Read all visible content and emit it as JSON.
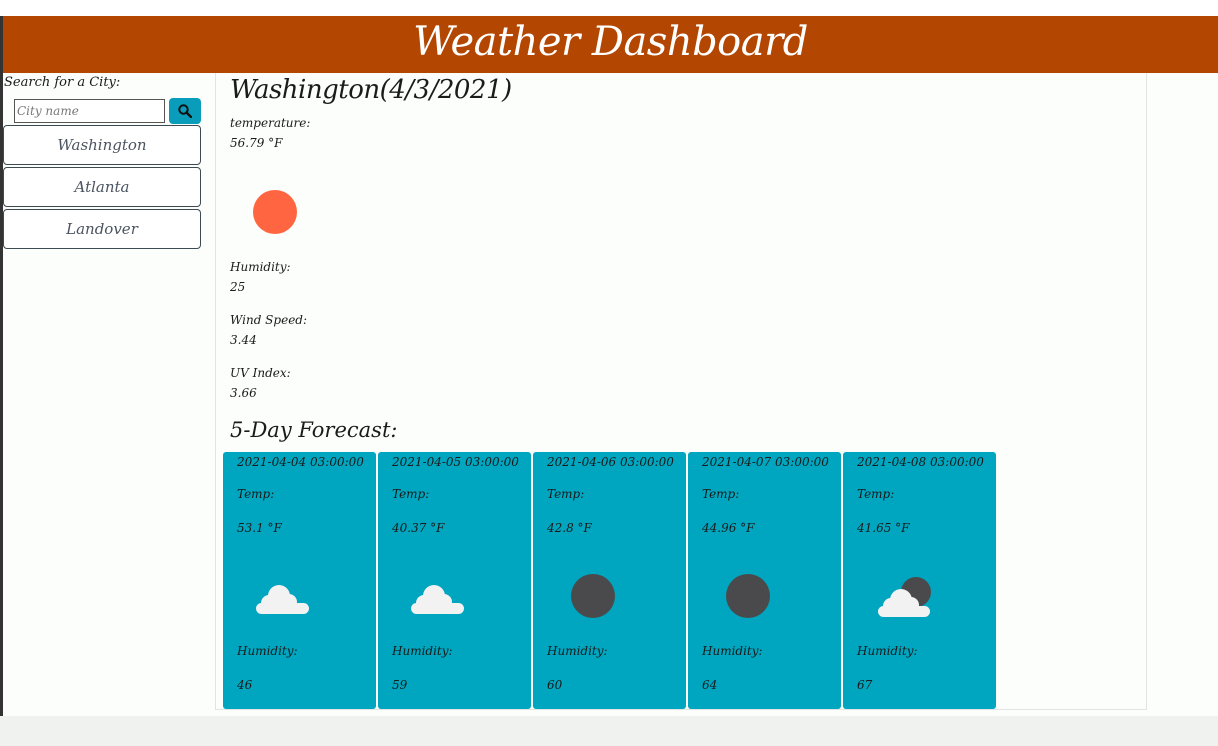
{
  "header": {
    "title": "Weather Dashboard"
  },
  "sidebar": {
    "search_label": "Search for a City:",
    "search_placeholder": "City name",
    "search_icon": "search-icon",
    "cities": [
      "Washington",
      "Atlanta",
      "Landover"
    ]
  },
  "current": {
    "title": "Washington(4/3/2021)",
    "temperature_label": "temperature:",
    "temperature_value": "56.79 °F",
    "icon": "sun-icon",
    "humidity_label": "Humidity:",
    "humidity_value": "25",
    "wind_label": "Wind Speed:",
    "wind_value": "3.44",
    "uv_label": "UV Index:",
    "uv_value": "3.66"
  },
  "forecast": {
    "title": "5-Day Forecast:",
    "temp_label": "Temp:",
    "humidity_label": "Humidity:",
    "days": [
      {
        "date": "2021-04-04 03:00:00",
        "temp": "53.1 °F",
        "humidity": "46",
        "icon": "cloud-icon"
      },
      {
        "date": "2021-04-05 03:00:00",
        "temp": "40.37 °F",
        "humidity": "59",
        "icon": "cloud-icon"
      },
      {
        "date": "2021-04-06 03:00:00",
        "temp": "42.8 °F",
        "humidity": "60",
        "icon": "moon-icon"
      },
      {
        "date": "2021-04-07 03:00:00",
        "temp": "44.96 °F",
        "humidity": "64",
        "icon": "moon-icon"
      },
      {
        "date": "2021-04-08 03:00:00",
        "temp": "41.65 °F",
        "humidity": "67",
        "icon": "cloud-moon-icon"
      }
    ]
  },
  "colors": {
    "header": "#b34600",
    "accent": "#00a6bf",
    "sun": "#ff6541"
  }
}
